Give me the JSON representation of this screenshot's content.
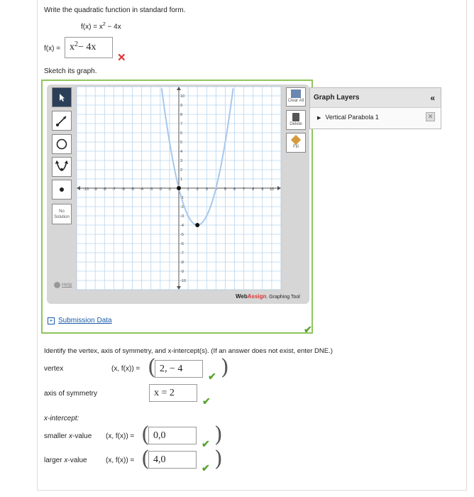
{
  "prompt": "Write the quadratic function in standard form.",
  "given_func_lhs": "f(x) = x",
  "given_func_exp": "2",
  "given_func_rhs": " − 4x",
  "answer1": {
    "lhs": "f(x) =",
    "value_base": "x",
    "value_exp": "2",
    "value_rest": " − 4x",
    "status": "incorrect"
  },
  "sketch_label": "Sketch its graph.",
  "tools": [
    "pointer",
    "line",
    "circle",
    "parabola",
    "point"
  ],
  "no_solution_label": "No Solution",
  "help_label": "Help",
  "right_tools": {
    "clear_all": "Clear All",
    "delete": "Delete",
    "fill": "Fill"
  },
  "graph_layers": {
    "title": "Graph Layers",
    "collapse": "«",
    "items": [
      {
        "label": "Vertical Parabola 1"
      }
    ]
  },
  "brand": {
    "web": "Web",
    "assign": "Assign",
    "suffix": ". Graphing Tool"
  },
  "submission_data": "Submission Data",
  "graph_status": "correct",
  "chart_data": {
    "type": "line",
    "xlim": [
      -11,
      11
    ],
    "ylim": [
      -11,
      11
    ],
    "grid": true,
    "x_ticks": [
      -10,
      -9,
      -8,
      -7,
      -6,
      -5,
      -4,
      -3,
      -2,
      -1,
      1,
      2,
      3,
      4,
      5,
      6,
      7,
      8,
      9,
      10
    ],
    "y_ticks": [
      -10,
      -9,
      -8,
      -7,
      -6,
      -5,
      -4,
      -3,
      -2,
      -1,
      1,
      2,
      3,
      4,
      5,
      6,
      7,
      8,
      9,
      10
    ],
    "series": [
      {
        "name": "Vertical Parabola 1",
        "equation": "y = x^2 - 4x",
        "vertex": [
          2,
          -4
        ],
        "points": [
          [
            0,
            0
          ],
          [
            2,
            -4
          ]
        ]
      }
    ]
  },
  "identify_prompt": "Identify the vertex, axis of symmetry, and x-intercept(s). (If an answer does not exist, enter DNE.)",
  "vertex": {
    "label": "vertex",
    "coord": "(x, f(x)) =",
    "value": "2, − 4",
    "status": "correct"
  },
  "axis": {
    "label": "axis of symmetry",
    "value": "x = 2",
    "status": "correct"
  },
  "xint_heading": "x-intercept:",
  "smaller": {
    "label_pre": "smaller ",
    "label_x": "x",
    "label_post": "-value",
    "coord": "(x, f(x)) =",
    "value": "0,0",
    "status": "correct"
  },
  "larger": {
    "label_pre": "larger ",
    "label_x": "x",
    "label_post": "-value",
    "coord": "(x, f(x)) =",
    "value": "4,0",
    "status": "correct"
  },
  "colors": {
    "accent_green": "#5aa432",
    "error_red": "#e03030",
    "link_blue": "#1a5aa8",
    "curve": "#a9c8ec",
    "tool_active": "#2b3f58"
  }
}
